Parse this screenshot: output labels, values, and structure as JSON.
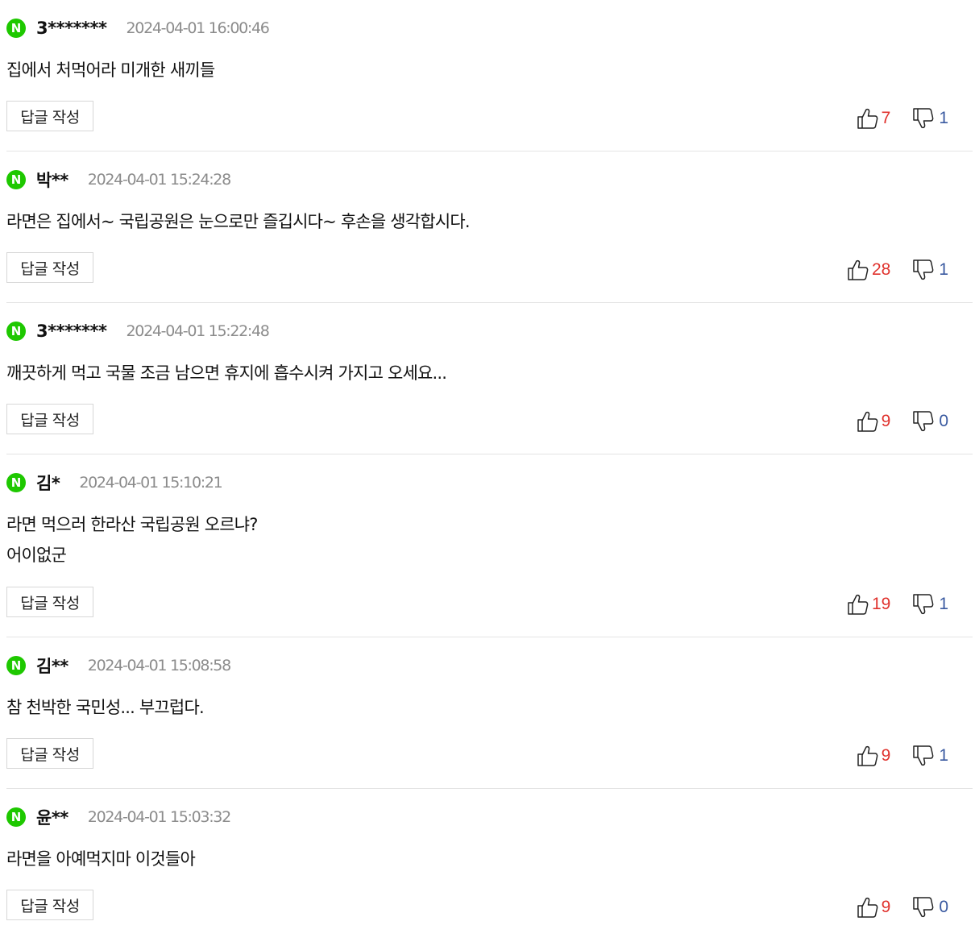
{
  "reply_label": "답글 작성",
  "badge_letter": "N",
  "colors": {
    "badge": "#1ec800",
    "like": "#e0322d",
    "dislike": "#3a5aa0",
    "timestamp": "#8c8c8c"
  },
  "comments": [
    {
      "author": "3*******",
      "timestamp": "2024-04-01 16:00:46",
      "lines": [
        "집에서 처먹어라 미개한 새끼들"
      ],
      "likes": "7",
      "dislikes": "1"
    },
    {
      "author": "박**",
      "timestamp": "2024-04-01 15:24:28",
      "lines": [
        "라면은 집에서~ 국립공원은 눈으로만 즐깁시다~ 후손을 생각합시다."
      ],
      "likes": "28",
      "dislikes": "1"
    },
    {
      "author": "3*******",
      "timestamp": "2024-04-01 15:22:48",
      "lines": [
        "깨끗하게 먹고 국물 조금 남으면 휴지에 흡수시켜 가지고 오세요..."
      ],
      "likes": "9",
      "dislikes": "0"
    },
    {
      "author": "김*",
      "timestamp": "2024-04-01 15:10:21",
      "lines": [
        "라면 먹으러 한라산 국립공원 오르냐?",
        "어이없군"
      ],
      "likes": "19",
      "dislikes": "1"
    },
    {
      "author": "김**",
      "timestamp": "2024-04-01 15:08:58",
      "lines": [
        "참 천박한 국민성... 부끄럽다."
      ],
      "likes": "9",
      "dislikes": "1"
    },
    {
      "author": "윤**",
      "timestamp": "2024-04-01 15:03:32",
      "lines": [
        "라면을 아예먹지마 이것들아"
      ],
      "likes": "9",
      "dislikes": "0"
    }
  ]
}
